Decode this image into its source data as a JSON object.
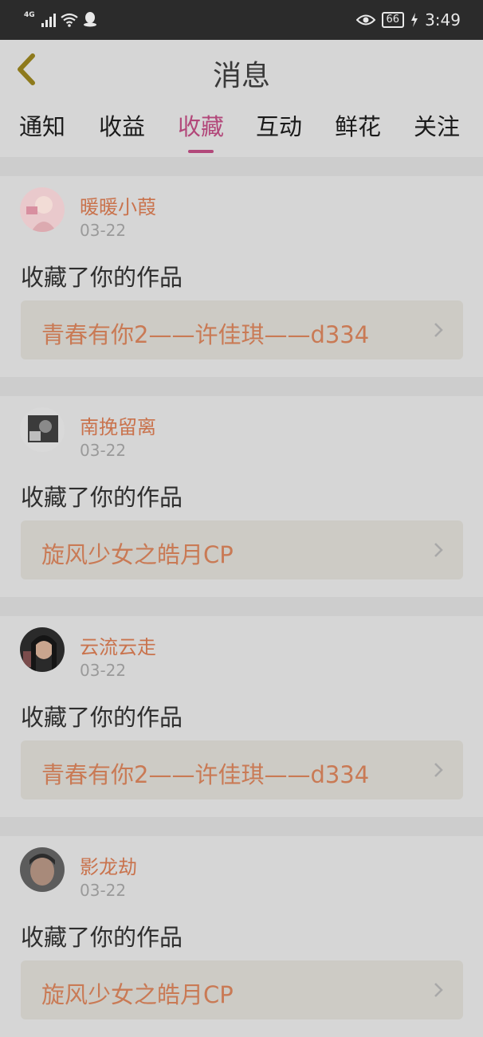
{
  "status": {
    "network": "4G",
    "battery": "66",
    "time": "3:49"
  },
  "header": {
    "title": "消息",
    "back_icon": "chevron-left-icon"
  },
  "tabs": [
    {
      "label": "通知",
      "active": false
    },
    {
      "label": "收益",
      "active": false
    },
    {
      "label": "收藏",
      "active": true
    },
    {
      "label": "互动",
      "active": false
    },
    {
      "label": "鲜花",
      "active": false
    },
    {
      "label": "关注",
      "active": false
    }
  ],
  "items": [
    {
      "user": "暖暖小葭",
      "date": "03-22",
      "action": "收藏了你的作品",
      "work": "青春有你2——许佳琪——d334"
    },
    {
      "user": "南挽留离",
      "date": "03-22",
      "action": "收藏了你的作品",
      "work": "旋风少女之皓月CP"
    },
    {
      "user": "云流云走",
      "date": "03-22",
      "action": "收藏了你的作品",
      "work": "青春有你2——许佳琪——d334"
    },
    {
      "user": "影龙劫",
      "date": "03-22",
      "action": "收藏了你的作品",
      "work": "旋风少女之皓月CP"
    }
  ],
  "colors": {
    "accent": "#b2487a",
    "username": "#c9734d",
    "work_title": "#c97a55"
  }
}
